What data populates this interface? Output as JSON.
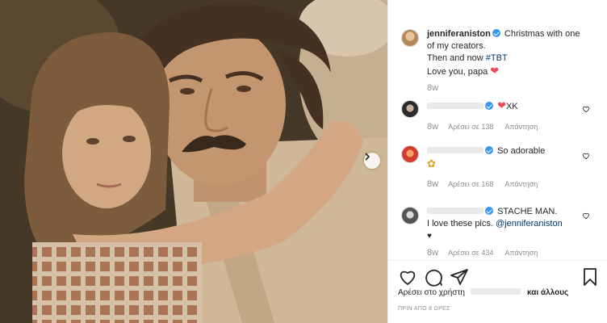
{
  "post": {
    "username": "jenniferaniston",
    "caption_line1": "Christmas with one",
    "caption_line2": "of my creators.",
    "caption_line3_prefix": "Then and now",
    "hashtag": "#TBT",
    "caption_line4": "Love you, papa",
    "time": "8w"
  },
  "comments": [
    {
      "text": "XK",
      "time": "8w",
      "likes": "Αρέσει σε 138",
      "reply": "Απάντηση"
    },
    {
      "text": "So adorable",
      "time": "8w",
      "likes": "Αρέσει σε 168",
      "reply": "Απάντηση"
    },
    {
      "text1": "STACHE MAN.",
      "text2": "I love these pics.",
      "mention": "@jenniferaniston",
      "time": "8w",
      "likes": "Αρέσει σε 434",
      "reply": "Απάντηση"
    }
  ],
  "footer": {
    "likes_prefix": "Αρέσει στο χρήστη",
    "likes_suffix": "και άλλους",
    "posted": "ΠΡΙΝ ΑΠΟ 8 ΩΡΕΣ"
  },
  "icons": [
    "heart-icon",
    "comment-icon",
    "share-icon",
    "bookmark-icon",
    "verified-icon",
    "next-arrow-icon"
  ],
  "colors": {
    "link": "#00376b",
    "heart": "#ed4956",
    "verified": "#3897f0",
    "meta": "#8e8e8e"
  }
}
